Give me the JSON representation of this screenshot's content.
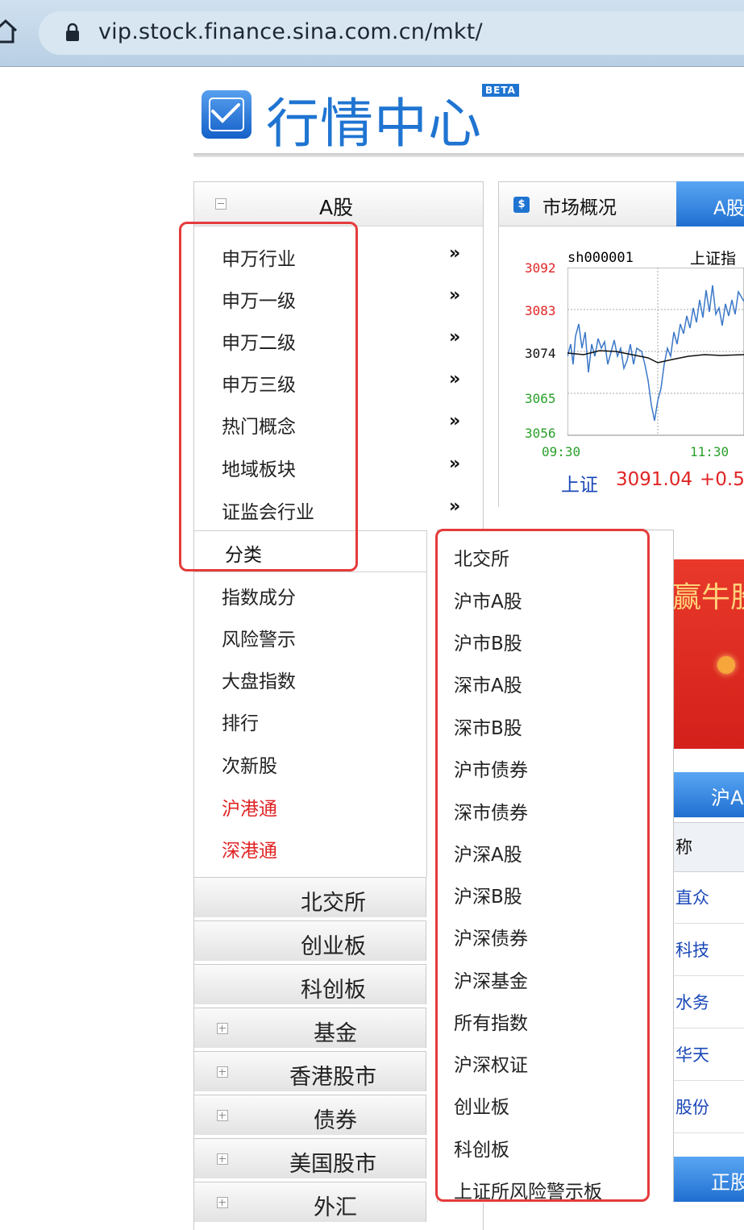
{
  "browser": {
    "url": "vip.stock.finance.sina.com.cn/mkt/"
  },
  "header": {
    "title": "行情中心",
    "badge": "BETA"
  },
  "nav": {
    "head_label": "A股",
    "top_items": [
      {
        "label": "申万行业",
        "arrow": "»"
      },
      {
        "label": "申万一级",
        "arrow": "»"
      },
      {
        "label": "申万二级",
        "arrow": "»"
      },
      {
        "label": "申万三级",
        "arrow": "»"
      },
      {
        "label": "热门概念",
        "arrow": "»"
      },
      {
        "label": "地域板块",
        "arrow": "»"
      },
      {
        "label": "证监会行业",
        "arrow": "»"
      }
    ],
    "classify_label": "分类",
    "lower_items": [
      {
        "label": "指数成分"
      },
      {
        "label": "风险警示"
      },
      {
        "label": "大盘指数"
      },
      {
        "label": "排行"
      },
      {
        "label": "次新股"
      },
      {
        "label": "沪港通"
      },
      {
        "label": "深港通"
      }
    ],
    "sections": [
      {
        "label": "北交所"
      },
      {
        "label": "创业板"
      },
      {
        "label": "科创板"
      },
      {
        "label": "基金"
      },
      {
        "label": "香港股市"
      },
      {
        "label": "债券"
      },
      {
        "label": "美国股市"
      },
      {
        "label": "外汇"
      }
    ]
  },
  "submenu": {
    "items": [
      "北交所",
      "沪市A股",
      "沪市B股",
      "深市A股",
      "深市B股",
      "沪市债券",
      "深市债券",
      "沪深A股",
      "沪深B股",
      "沪深债券",
      "沪深基金",
      "所有指数",
      "沪深权证",
      "创业板",
      "科创板",
      "上证所风险警示板"
    ]
  },
  "tabs": {
    "market": "市场概况",
    "market_icon": "$",
    "ashare": "A股"
  },
  "chart": {
    "code": "sh000001",
    "name": "上证指",
    "y_ticks": [
      "3092",
      "3083",
      "3074",
      "3065",
      "3056"
    ],
    "x_ticks": [
      "09:30",
      "11:30"
    ],
    "quote_name": "上证",
    "quote_value": "3091.04",
    "quote_change": "+0.5"
  },
  "banner": {
    "text": "赢牛股"
  },
  "right_tabs": {
    "first": "沪A",
    "second": "正股"
  },
  "table": {
    "header": "称",
    "rows": [
      "直众",
      "科技",
      "水务",
      "华天",
      "股份"
    ]
  },
  "colors": {
    "accent": "#1f74d1",
    "highlight": "#e53b3b",
    "red_text": "#e02424"
  }
}
